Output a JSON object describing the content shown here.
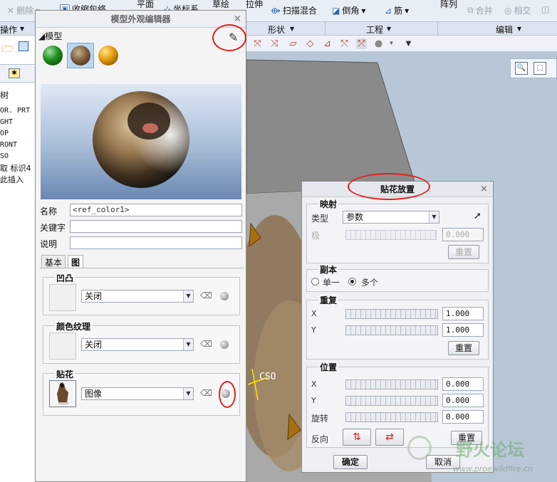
{
  "ribbon": {
    "delete_label": "删除",
    "fold_label": "收缩包络",
    "plane_label": "平面",
    "coord_label": "坐标系",
    "sketch_label": "草绘",
    "extrude_label": "拉伸",
    "sweep_blend_label": "扫描混合",
    "chamfer_label": "倒角",
    "rib_label": "筋",
    "pattern_label": "阵列",
    "merge_label": "合并",
    "intersect_label": "相交",
    "ops_group": "操作",
    "shape_group": "形状",
    "engineering_group": "工程",
    "edit_group": "编辑"
  },
  "tree": {
    "tab_star": "✱",
    "items": [
      "树",
      "OR. PRT",
      "GHT",
      "OP",
      "RONT",
      "SO",
      "取 标识4",
      "此插入"
    ]
  },
  "editor": {
    "title": "模型外观编辑器",
    "model_section": "模型",
    "name_label": "名称",
    "name_value": "<ref_color1>",
    "keyword_label": "关键字",
    "keyword_value": "",
    "desc_label": "说明",
    "desc_value": "",
    "tab_basic": "基本",
    "tab_map": "图",
    "bump_title": "凹凸",
    "bump_value": "关闭",
    "color_texture_title": "颜色纹理",
    "color_texture_value": "关闭",
    "decal_title": "贴花",
    "decal_value": "图像"
  },
  "decal_dialog": {
    "title": "贴花放置",
    "mapping_title": "映射",
    "type_label": "类型",
    "type_value": "参数",
    "pole_label": "极",
    "pole_value": "0.000",
    "reset_label": "重置",
    "copy_title": "副本",
    "single_label": "单一",
    "multiple_label": "多个",
    "repeat_title": "重复",
    "repeat_x_label": "X",
    "repeat_x_value": "1.000",
    "repeat_y_label": "Y",
    "repeat_y_value": "1.000",
    "position_title": "位置",
    "pos_x_label": "X",
    "pos_x_value": "0.000",
    "pos_y_label": "Y",
    "pos_y_value": "0.000",
    "rotate_label": "旋转",
    "rotate_value": "0.000",
    "flip_label": "反向",
    "ok_label": "确定",
    "cancel_label": "取消"
  },
  "viewport": {
    "csys_label": "CSO"
  },
  "watermark": {
    "text": "野火论坛",
    "url": "www.proewildfire.cn"
  },
  "colors": {
    "accent_red": "#e0201c",
    "ribbon_bg": "#e8eef6",
    "viewport_bg": "#b8c7d8"
  }
}
